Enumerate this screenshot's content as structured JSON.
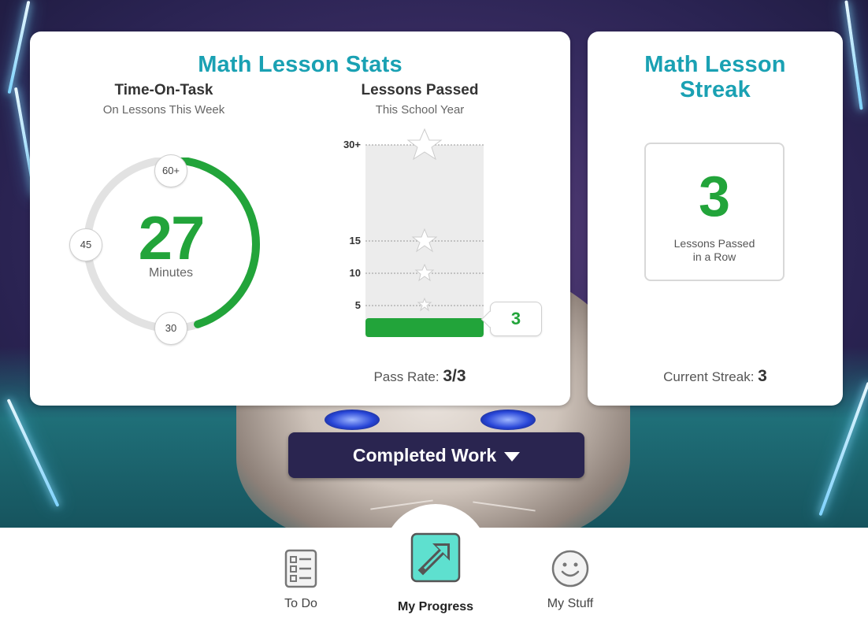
{
  "stats_card": {
    "title": "Math Lesson Stats",
    "time_on_task": {
      "heading": "Time-On-Task",
      "subheading": "On Lessons This Week",
      "minutes_value": "27",
      "minutes_unit": "Minutes",
      "badge_labels": [
        "60+",
        "45",
        "30"
      ],
      "progress_fraction": 0.45
    },
    "lessons_passed": {
      "heading": "Lessons Passed",
      "subheading": "This School Year",
      "tick_labels": [
        "30+",
        "15",
        "10",
        "5"
      ],
      "current_value": "3",
      "pass_rate_label": "Pass Rate:",
      "pass_rate_value": "3/3"
    }
  },
  "streak_card": {
    "title_line1": "Math Lesson",
    "title_line2": "Streak",
    "streak_value": "3",
    "streak_label_line1": "Lessons Passed",
    "streak_label_line2": "in a Row",
    "current_streak_label": "Current Streak:",
    "current_streak_value": "3"
  },
  "completed_work_button": {
    "label": "Completed Work"
  },
  "bottom_nav": {
    "items": [
      {
        "label": "To Do",
        "icon": "checklist-icon"
      },
      {
        "label": "My Progress",
        "icon": "arrow-up-right-icon"
      },
      {
        "label": "My Stuff",
        "icon": "smiley-face-icon"
      }
    ],
    "active_index": 1
  },
  "colors": {
    "teal_title": "#1aa1b3",
    "green_accent": "#22a43a",
    "nav_dark": "#2a2550",
    "progress_tile": "#5ee0cf"
  }
}
